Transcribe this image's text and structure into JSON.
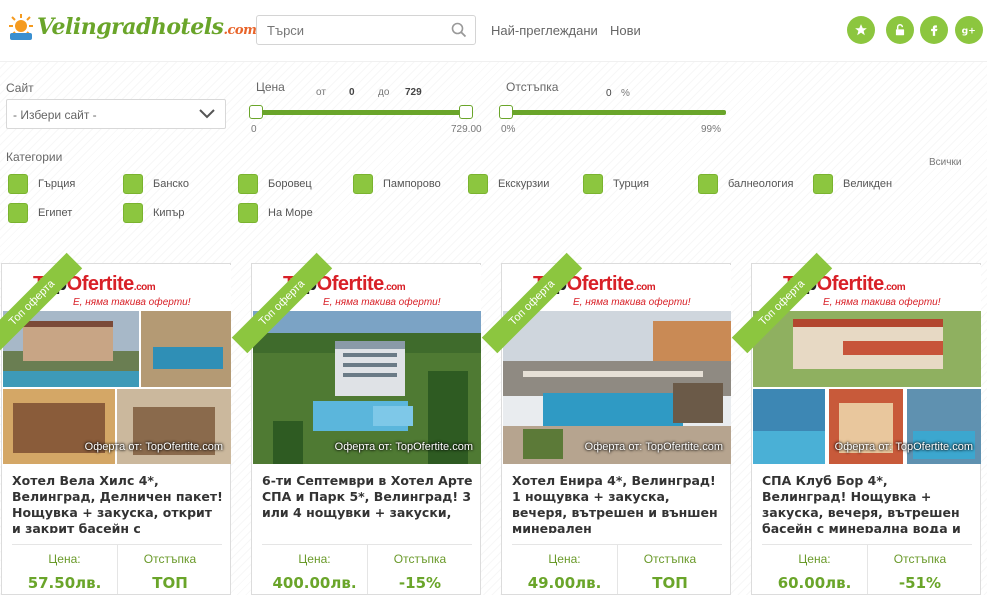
{
  "header": {
    "logo_main": "Velingradhotels",
    "logo_tld": ".com",
    "search_placeholder": "Търси",
    "nav": [
      "Най-преглеждани",
      "Нови"
    ],
    "social_icons": [
      "star-icon",
      "lock-icon",
      "facebook-icon",
      "google-plus-icon"
    ]
  },
  "filters": {
    "site_label": "Сайт",
    "site_select": "- Избери сайт -",
    "price_label": "Цена",
    "price_from_label": "от",
    "price_from": "0",
    "price_to_label": "до",
    "price_to": "729",
    "price_min": "0",
    "price_max": "729.00",
    "discount_label": "Отстъпка",
    "discount_value": "0",
    "discount_unit": "%",
    "discount_min": "0%",
    "discount_max": "99%",
    "categories_label": "Категории",
    "all_label": "Всички",
    "categories": [
      "Гърция",
      "Банско",
      "Боровец",
      "Пампорово",
      "Екскурзии",
      "Турция",
      "балнеология",
      "Великден",
      "Египет",
      "Кипър",
      "На Море"
    ]
  },
  "cards": [
    {
      "ribbon": "Топ оферта",
      "brand_t": "T",
      "brand_o": "op",
      "brand_rest": "Ofertite",
      "brand_com": ".com",
      "tagline": "Е, няма такива оферти!",
      "offer_by": "Оферта от: TopOfertite.com",
      "title": "Хотел Вела Хилс 4*, Велинград, Делничен пакет! Нощувка + закуска, открит и закрит басейн с",
      "price_label": "Цена:",
      "price": "57.50лв.",
      "discount_label": "Отстъпка",
      "discount": "ТОП"
    },
    {
      "ribbon": "Топ оферта",
      "brand_t": "T",
      "brand_o": "op",
      "brand_rest": "Ofertite",
      "brand_com": ".com",
      "tagline": "Е, няма такива оферти!",
      "offer_by": "Оферта от: TopOfertite.com",
      "title": "6-ти Септември в Хотел Арте СПА и Парк 5*, Велинград! 3 или 4 нощувки + закуски,",
      "price_label": "Цена:",
      "price": "400.00лв.",
      "discount_label": "Отстъпка",
      "discount": "-15%"
    },
    {
      "ribbon": "Топ оферта",
      "brand_t": "T",
      "brand_o": "op",
      "brand_rest": "Ofertite",
      "brand_com": ".com",
      "tagline": "Е, няма такива оферти!",
      "offer_by": "Оферта от: TopOfertite.com",
      "title": "Хотел Енира 4*, Велинград! 1 нощувка + закуска, вечеря, вътрешен и външен минерален",
      "price_label": "Цена:",
      "price": "49.00лв.",
      "discount_label": "Отстъпка",
      "discount": "ТОП"
    },
    {
      "ribbon": "Топ оферта",
      "brand_t": "T",
      "brand_o": "op",
      "brand_rest": "Ofertite",
      "brand_com": ".com",
      "tagline": "Е, няма такива оферти!",
      "offer_by": "Оферта от: TopOfertite.com",
      "title": "СПА Клуб Бор 4*, Велинград! Нощувка + закуска, вечеря, вътрешен басейн с минерална вода и",
      "price_label": "Цена:",
      "price": "60.00лв.",
      "discount_label": "Отстъпка",
      "discount": "-51%"
    }
  ]
}
